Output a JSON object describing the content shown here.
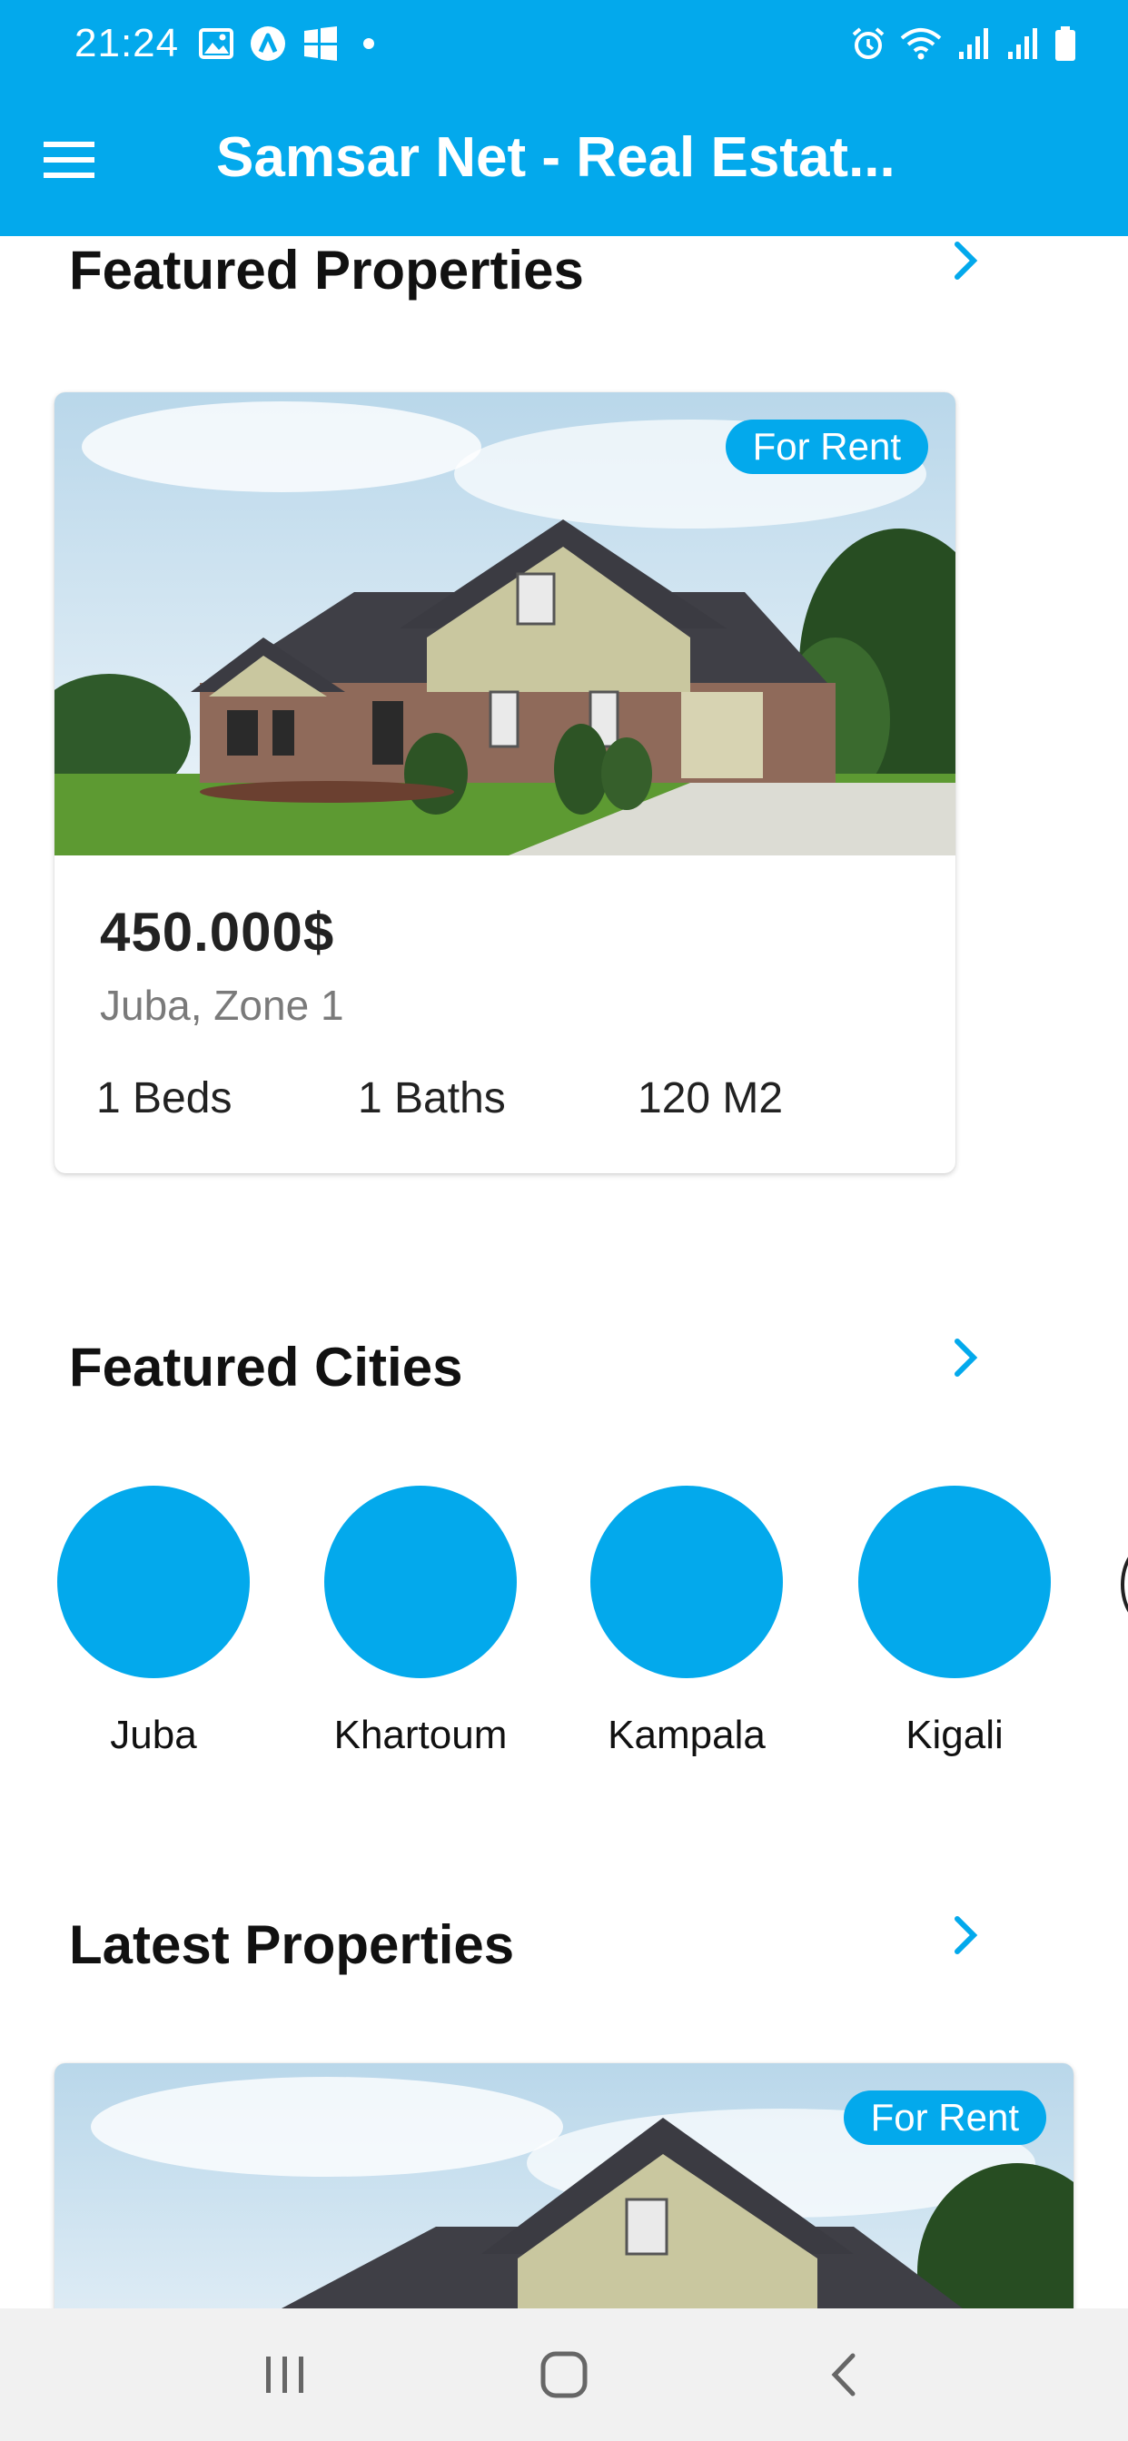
{
  "status_bar": {
    "time": "21:24",
    "left_icons": [
      "gallery-icon",
      "app-a-icon",
      "windows-icon",
      "dot-icon"
    ],
    "right_icons": [
      "alarm-icon",
      "wifi-icon",
      "signal-icon",
      "signal-icon",
      "battery-icon"
    ]
  },
  "app_bar": {
    "title": "Samsar Net - Real Estat...",
    "menu_icon": "hamburger-menu-icon",
    "color": "#03a9ec"
  },
  "featured_properties": {
    "title": "Featured Properties",
    "items": [
      {
        "badge": "For Rent",
        "price": "450.000$",
        "location": "Juba, Zone 1",
        "beds": "1 Beds",
        "baths": "1 Baths",
        "area": "120 M2"
      }
    ]
  },
  "featured_cities": {
    "title": "Featured Cities",
    "items": [
      {
        "name": "Juba"
      },
      {
        "name": "Khartoum"
      },
      {
        "name": "Kampala"
      },
      {
        "name": "Kigali"
      }
    ]
  },
  "latest_properties": {
    "title": "Latest Properties",
    "items": [
      {
        "badge": "For Rent"
      }
    ]
  },
  "nav_bar": {
    "buttons": [
      "recent-apps-icon",
      "home-icon",
      "back-icon"
    ]
  },
  "colors": {
    "accent": "#03a9ec",
    "text_primary": "#111111",
    "text_secondary": "#7a7a7a"
  }
}
